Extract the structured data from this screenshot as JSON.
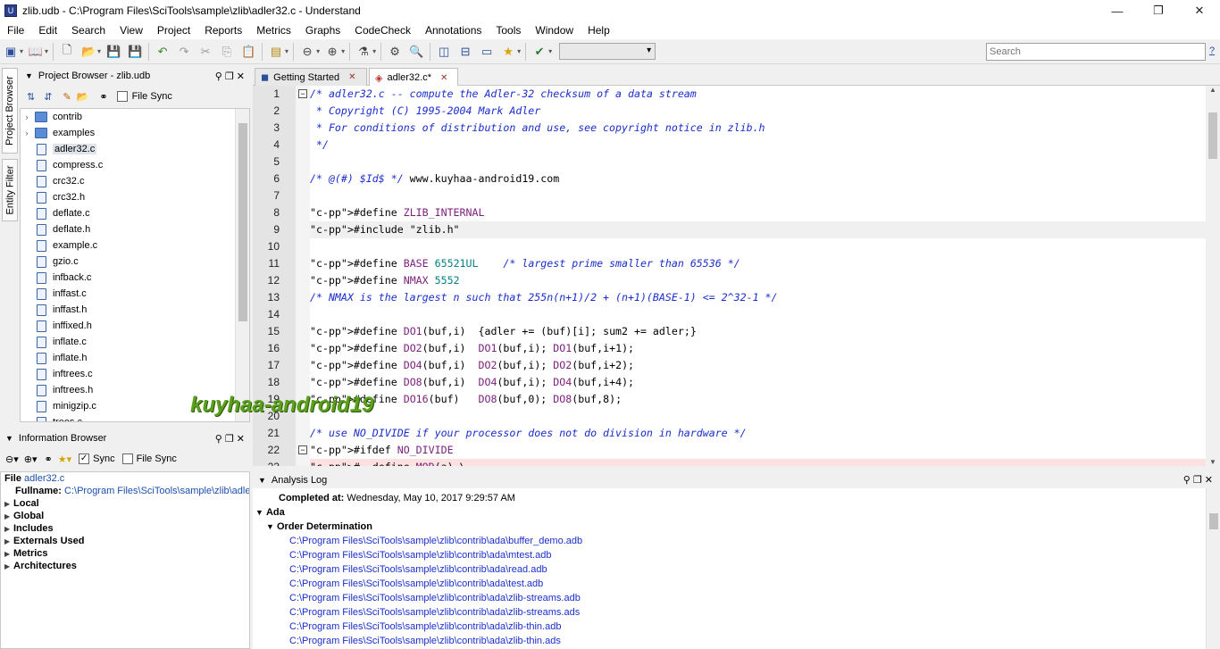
{
  "window": {
    "title": "zlib.udb - C:\\Program Files\\SciTools\\sample\\zlib\\adler32.c - Understand",
    "app_icon": "U",
    "minimize": "—",
    "maximize": "❐",
    "close": "✕"
  },
  "menu": [
    "File",
    "Edit",
    "Search",
    "View",
    "Project",
    "Reports",
    "Metrics",
    "Graphs",
    "CodeCheck",
    "Annotations",
    "Tools",
    "Window",
    "Help"
  ],
  "search": {
    "placeholder": "Search"
  },
  "help_label": "?",
  "side_tabs": {
    "project_browser": "Project Browser",
    "entity_filter": "Entity Filter"
  },
  "project_browser": {
    "title": "Project Browser - zlib.udb",
    "file_sync": "File Sync",
    "items": [
      {
        "label": "contrib",
        "kind": "folder"
      },
      {
        "label": "examples",
        "kind": "folder"
      },
      {
        "label": "adler32.c",
        "kind": "file",
        "selected": true
      },
      {
        "label": "compress.c",
        "kind": "file"
      },
      {
        "label": "crc32.c",
        "kind": "file"
      },
      {
        "label": "crc32.h",
        "kind": "file"
      },
      {
        "label": "deflate.c",
        "kind": "file"
      },
      {
        "label": "deflate.h",
        "kind": "file"
      },
      {
        "label": "example.c",
        "kind": "file"
      },
      {
        "label": "gzio.c",
        "kind": "file"
      },
      {
        "label": "infback.c",
        "kind": "file"
      },
      {
        "label": "inffast.c",
        "kind": "file"
      },
      {
        "label": "inffast.h",
        "kind": "file"
      },
      {
        "label": "inffixed.h",
        "kind": "file"
      },
      {
        "label": "inflate.c",
        "kind": "file"
      },
      {
        "label": "inflate.h",
        "kind": "file"
      },
      {
        "label": "inftrees.c",
        "kind": "file"
      },
      {
        "label": "inftrees.h",
        "kind": "file"
      },
      {
        "label": "minigzip.c",
        "kind": "file"
      },
      {
        "label": "trees.c",
        "kind": "file"
      }
    ]
  },
  "info_browser": {
    "title": "Information Browser",
    "sync": "Sync",
    "file_sync": "File Sync",
    "file_label": "File",
    "file_value": "adler32.c",
    "fullname_label": "Fullname:",
    "fullname_value": "C:\\Program Files\\SciTools\\sample\\zlib\\adler",
    "sections": [
      "Local",
      "Global",
      "Includes",
      "Externals Used",
      "Metrics",
      "Architectures"
    ]
  },
  "tabs": [
    {
      "label": "Getting Started",
      "close": "✕"
    },
    {
      "label": "adler32.c*",
      "close": "✕"
    }
  ],
  "code_lines": [
    {
      "n": "1",
      "t": "/* adler32.c -- compute the Adler-32 checksum of a data stream"
    },
    {
      "n": "2",
      "t": " * Copyright (C) 1995-2004 Mark Adler"
    },
    {
      "n": "3",
      "t": " * For conditions of distribution and use, see copyright notice in zlib.h"
    },
    {
      "n": "4",
      "t": " */"
    },
    {
      "n": "5",
      "t": ""
    },
    {
      "n": "6",
      "t": "/* @(#) $Id$ */ www.kuyhaa-android19.com"
    },
    {
      "n": "7",
      "t": ""
    },
    {
      "n": "8",
      "t": "#define ZLIB_INTERNAL"
    },
    {
      "n": "9",
      "t": "#include \"zlib.h\""
    },
    {
      "n": "10",
      "t": ""
    },
    {
      "n": "11",
      "t": "#define BASE 65521UL    /* largest prime smaller than 65536 */"
    },
    {
      "n": "12",
      "t": "#define NMAX 5552"
    },
    {
      "n": "13",
      "t": "/* NMAX is the largest n such that 255n(n+1)/2 + (n+1)(BASE-1) <= 2^32-1 */"
    },
    {
      "n": "14",
      "t": ""
    },
    {
      "n": "15",
      "t": "#define DO1(buf,i)  {adler += (buf)[i]; sum2 += adler;}"
    },
    {
      "n": "16",
      "t": "#define DO2(buf,i)  DO1(buf,i); DO1(buf,i+1);"
    },
    {
      "n": "17",
      "t": "#define DO4(buf,i)  DO2(buf,i); DO2(buf,i+2);"
    },
    {
      "n": "18",
      "t": "#define DO8(buf,i)  DO4(buf,i); DO4(buf,i+4);"
    },
    {
      "n": "19",
      "t": "#define DO16(buf)   DO8(buf,0); DO8(buf,8);"
    },
    {
      "n": "20",
      "t": ""
    },
    {
      "n": "21",
      "t": "/* use NO_DIVIDE if your processor does not do division in hardware */"
    },
    {
      "n": "22",
      "t": "#ifdef NO_DIVIDE"
    },
    {
      "n": "23",
      "t": "#  define MOD(a) \\"
    }
  ],
  "analysis_log": {
    "title": "Analysis Log",
    "completed_label": "Completed at:",
    "completed_value": "Wednesday, May 10, 2017 9:29:57 AM",
    "group": "Ada",
    "subgroup": "Order Determination",
    "files": [
      "C:\\Program Files\\SciTools\\sample\\zlib\\contrib\\ada\\buffer_demo.adb",
      "C:\\Program Files\\SciTools\\sample\\zlib\\contrib\\ada\\mtest.adb",
      "C:\\Program Files\\SciTools\\sample\\zlib\\contrib\\ada\\read.adb",
      "C:\\Program Files\\SciTools\\sample\\zlib\\contrib\\ada\\test.adb",
      "C:\\Program Files\\SciTools\\sample\\zlib\\contrib\\ada\\zlib-streams.adb",
      "C:\\Program Files\\SciTools\\sample\\zlib\\contrib\\ada\\zlib-streams.ads",
      "C:\\Program Files\\SciTools\\sample\\zlib\\contrib\\ada\\zlib-thin.adb",
      "C:\\Program Files\\SciTools\\sample\\zlib\\contrib\\ada\\zlib-thin.ads"
    ]
  },
  "watermark": "kuyhaa-android19",
  "colors": {
    "comment": "#1a2ecc",
    "preprocessor": "#1f7a1f",
    "macro": "#7b1f7b",
    "string": "#b01010",
    "number": "#008080",
    "current_line": "#f0f0f0",
    "error_line": "#fde0e0"
  }
}
